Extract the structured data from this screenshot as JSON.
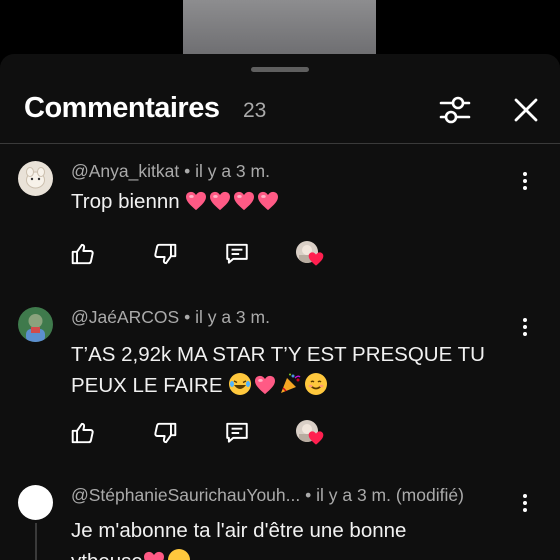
{
  "panel": {
    "title": "Commentaires",
    "count": "23"
  },
  "colors": {
    "background": "#0f0f0f",
    "heart": "#ff3b6b",
    "secondary_text": "#aaaaaa"
  },
  "comments": [
    {
      "author": "@Anya_kitkat",
      "time": " • il y a 3 m.",
      "text": "Trop biennn",
      "emojis": [
        "pink-heart",
        "pink-heart",
        "pink-heart",
        "pink-heart"
      ]
    },
    {
      "author": "@JaéARCOS",
      "time": " • il y a 3 m.",
      "text": "T’AS 2,92k MA STAR T’Y EST PRESQUE TU PEUX LE FAIRE",
      "emojis": [
        "laughing-tears",
        "pink-heart",
        "party-popper",
        "smiling-face"
      ]
    },
    {
      "author": "@StéphanieSaurichauYouh...",
      "time": " • il y a 3 m. (modifié)",
      "text": "Je m'abonne ta l'air d'être une bonne",
      "text_line2": "ytbeuse"
    }
  ]
}
